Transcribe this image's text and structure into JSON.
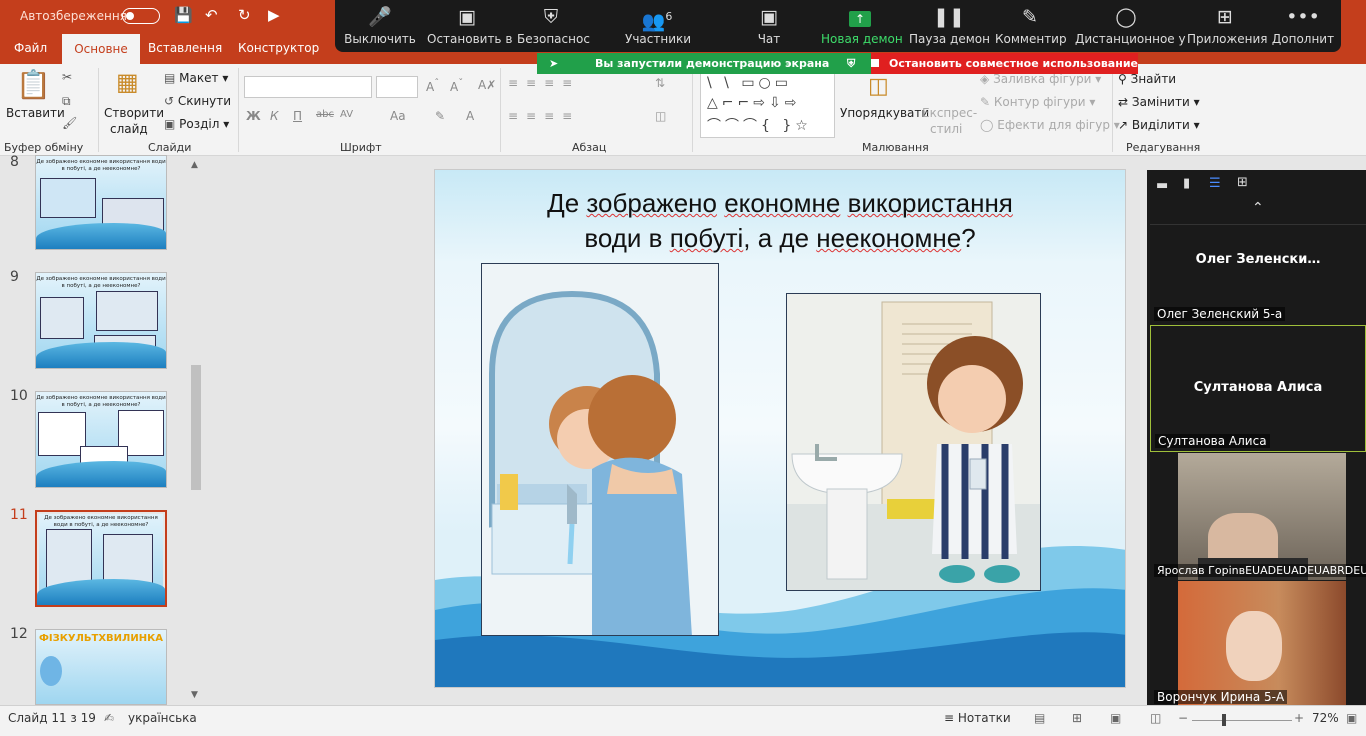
{
  "titlebar": {
    "autosave": "Автозбереження"
  },
  "tabs": [
    "Файл",
    "Основне",
    "Вставлення",
    "Конструктор"
  ],
  "ribbon": {
    "clipboard": {
      "paste": "Вставити",
      "group": "Буфер обміну"
    },
    "slides": {
      "new_slide_1": "Створити",
      "new_slide_2": "слайд",
      "layout": "Макет",
      "reset": "Скинути",
      "section": "Розділ",
      "group": "Слайди"
    },
    "font": {
      "bold": "Ж",
      "italic": "К",
      "underline": "П",
      "strike": "abc",
      "spacing": "AV",
      "case": "Aa",
      "group": "Шрифт"
    },
    "paragraph": {
      "group": "Абзац"
    },
    "drawing": {
      "arrange_1": "Упорядкувати",
      "express_1": "Експрес-",
      "express_2": "стилі",
      "fill": "Заливка фігури",
      "outline": "Контур фігури",
      "effects": "Ефекти для фігур",
      "group": "Малювання"
    },
    "editing": {
      "find": "Знайти",
      "replace": "Замінити",
      "select": "Виділити",
      "group": "Редагування"
    }
  },
  "zoom": {
    "buttons": [
      {
        "label": "Выключить",
        "icon": "microphone-icon"
      },
      {
        "label": "Остановить в",
        "icon": "video-camera-icon"
      },
      {
        "label": "Безопаснос",
        "icon": "security-shield-icon"
      },
      {
        "label": "Участники",
        "icon": "participants-icon",
        "count": "6"
      },
      {
        "label": "Чат",
        "icon": "chat-bubble-icon"
      },
      {
        "label": "Новая демон",
        "icon": "share-up-arrow-icon"
      },
      {
        "label": "Пауза демон",
        "icon": "pause-icon"
      },
      {
        "label": "Комментир",
        "icon": "pencil-icon"
      },
      {
        "label": "Дистанционное у",
        "icon": "mouse-icon"
      },
      {
        "label": "Приложения",
        "icon": "apps-icon"
      },
      {
        "label": "Дополнит",
        "icon": "more-dots-icon"
      }
    ],
    "share_notice": "Вы запустили демонстрацию экрана",
    "stop_share": "Остановить совместное использование",
    "accent_green": "#21a04a",
    "accent_red": "#e02020"
  },
  "thumbnails": [
    {
      "num": "8",
      "title": "Де зображено економне використання води в побуті, а де неекономне?"
    },
    {
      "num": "9",
      "title": "Де зображено економне використання води в побуті, а де неекономне?"
    },
    {
      "num": "10",
      "title": "Де зображено економне використання води в побуті, а де неекономне?"
    },
    {
      "num": "11",
      "title": "Де зображено економне використання води в побуті, а де неекономне?"
    },
    {
      "num": "12",
      "title": "ФІЗКУЛЬТХВИЛИНКА"
    }
  ],
  "slide": {
    "title_line1_a": "Де ",
    "title_line1_b": "зображено",
    "title_line1_c": " ",
    "title_line1_d": "економне",
    "title_line1_e": " ",
    "title_line1_f": "використання",
    "title_line2_a": "води в ",
    "title_line2_b": "побуті",
    "title_line2_c": ", а де ",
    "title_line2_d": "неекономне",
    "title_line2_e": "?"
  },
  "participants": [
    {
      "display": "Олег  Зеленски…",
      "label": "Олег Зеленский 5-а"
    },
    {
      "display": "Султанова Алиса",
      "label": "Султанова Алиса"
    },
    {
      "label": "Ярослав ГоріnвEUADEUADEUABRDEUA❤"
    },
    {
      "label": "Ворончук Ирина 5-А"
    }
  ],
  "status": {
    "slide": "Слайд 11 з 19",
    "language": "українська",
    "notes": "Нотатки",
    "zoom": "72%"
  }
}
